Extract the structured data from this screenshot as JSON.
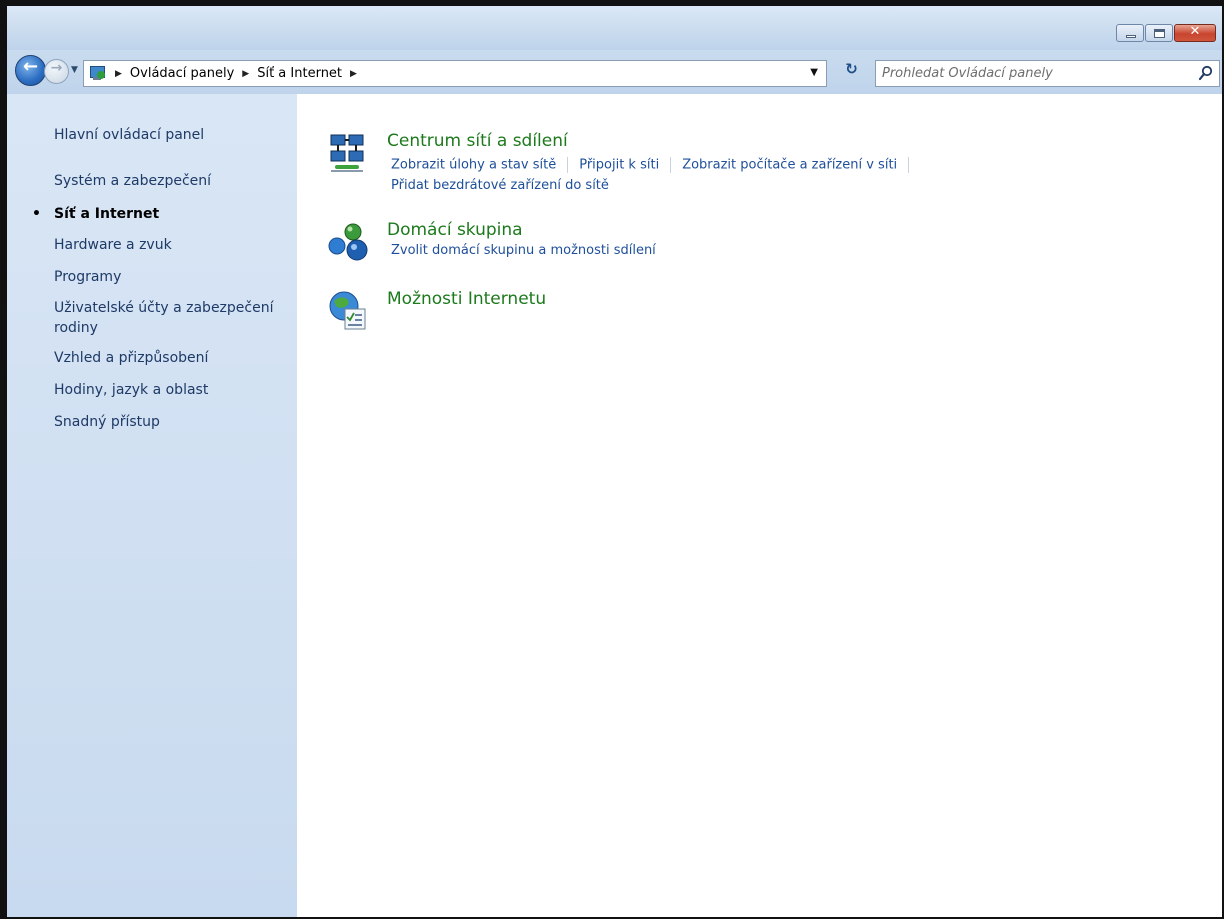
{
  "window": {
    "buttons": [
      "minimize",
      "maximize",
      "close"
    ]
  },
  "nav": {
    "breadcrumb": [
      "Ovládací panely",
      "Síť a Internet"
    ],
    "search_placeholder": "Prohledat Ovládací panely"
  },
  "sidebar": {
    "items": [
      {
        "label": "Hlavní ovládací panel",
        "current": false
      },
      {
        "label": "Systém a zabezpečení",
        "current": false
      },
      {
        "label": "Síť a Internet",
        "current": true
      },
      {
        "label": "Hardware a zvuk",
        "current": false
      },
      {
        "label": "Programy",
        "current": false
      },
      {
        "label": "Uživatelské účty a zabezpečení rodiny",
        "current": false
      },
      {
        "label": "Vzhled a přizpůsobení",
        "current": false
      },
      {
        "label": "Hodiny, jazyk a oblast",
        "current": false
      },
      {
        "label": "Snadný přístup",
        "current": false
      }
    ]
  },
  "categories": [
    {
      "title": "Centrum sítí a sdílení",
      "icon": "network-center-icon",
      "links": [
        "Zobrazit úlohy a stav sítě",
        "Připojit k síti",
        "Zobrazit počítače a zařízení v síti",
        "Přidat bezdrátové zařízení do sítě"
      ]
    },
    {
      "title": "Domácí skupina",
      "icon": "homegroup-icon",
      "links": [
        "Zvolit domácí skupinu a možnosti sdílení"
      ]
    },
    {
      "title": "Možnosti Internetu",
      "icon": "internet-options-icon",
      "links": []
    }
  ],
  "colors": {
    "link": "#1e4f9a",
    "category_title": "#1c7a1c",
    "sidebar_bg": "#d9e6f5"
  }
}
